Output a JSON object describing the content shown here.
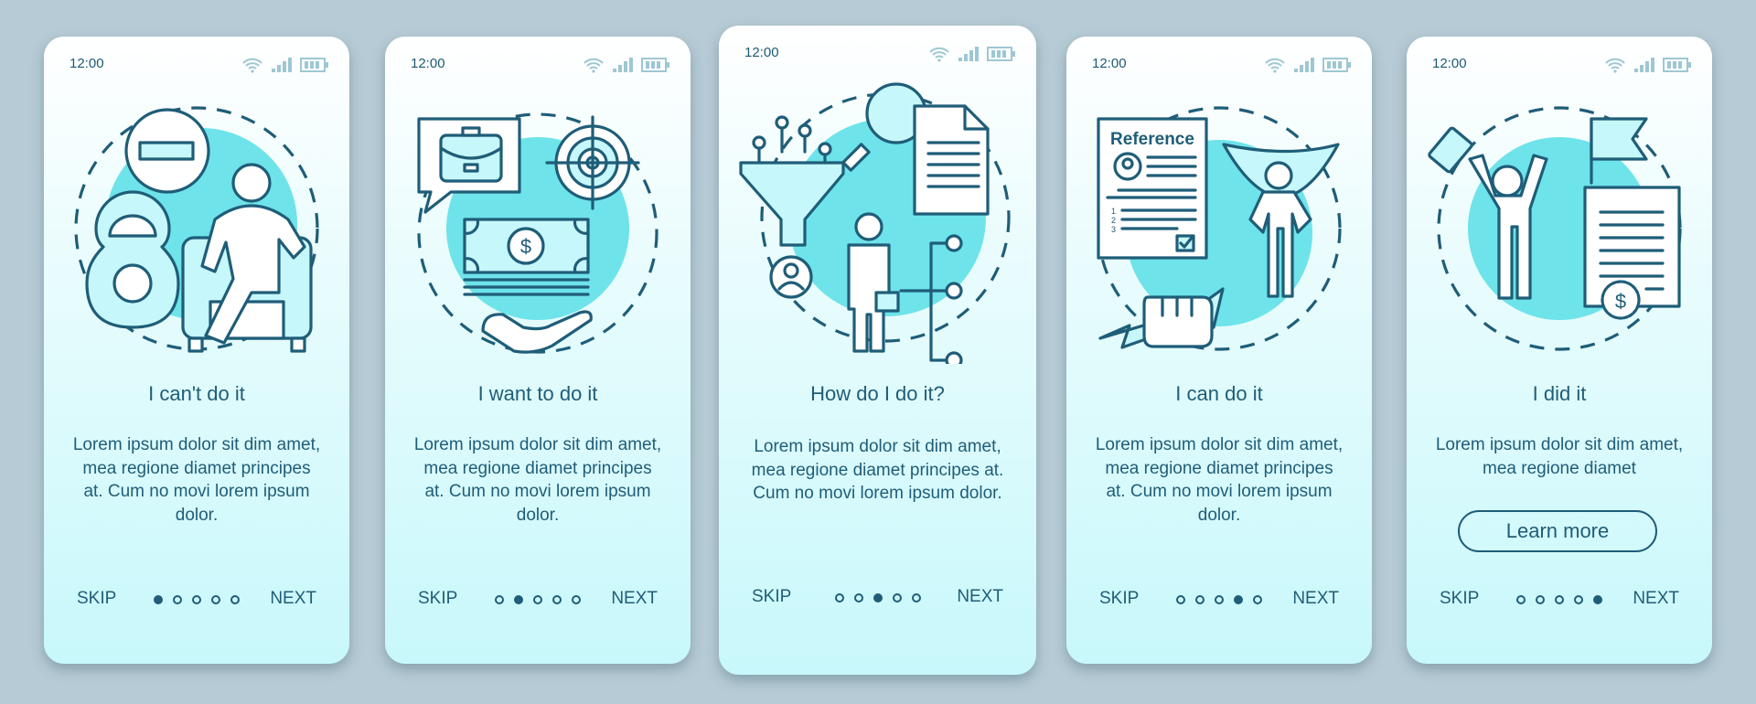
{
  "status_bar": {
    "time": "12:00",
    "icons": [
      "wifi-icon",
      "signal-icon",
      "battery-icon"
    ]
  },
  "colors": {
    "background": "#b6cbd5",
    "accent": "#6ee3ea",
    "text": "#1f5d78",
    "card_bottom": "#c8f8fb"
  },
  "screens": [
    {
      "title": "I can't do it",
      "description": "Lorem ipsum dolor sit dim amet, mea regione diamet principes at. Cum no movi lorem ipsum dolor.",
      "illustration": "person-in-armchair-with-kettlebell-and-minus-sign",
      "skip_label": "SKIP",
      "next_label": "NEXT",
      "page": 1,
      "total_pages": 5
    },
    {
      "title": "I want to do it",
      "description": "Lorem ipsum dolor sit dim amet, mea regione diamet principes at. Cum no movi lorem ipsum dolor.",
      "illustration": "briefcase-target-money-hand",
      "skip_label": "SKIP",
      "next_label": "NEXT",
      "page": 2,
      "total_pages": 5
    },
    {
      "title": "How do I do it?",
      "description": "Lorem ipsum dolor sit dim amet, mea regione diamet principes at. Cum no movi lorem ipsum dolor.",
      "illustration": "funnel-magnifier-document-businessman",
      "skip_label": "SKIP",
      "next_label": "NEXT",
      "page": 3,
      "total_pages": 5
    },
    {
      "title": "I can do it",
      "description": "Lorem ipsum dolor sit dim amet, mea regione diamet principes at. Cum no movi lorem ipsum dolor.",
      "illustration": "reference-document-superhero-fist",
      "reference_label": "Reference",
      "list_numbers": [
        "1",
        "2",
        "3"
      ],
      "skip_label": "SKIP",
      "next_label": "NEXT",
      "page": 4,
      "total_pages": 5
    },
    {
      "title": "I did it",
      "description": "Lorem ipsum dolor sit dim amet, mea regione diamet",
      "illustration": "celebrating-person-flag-certificate",
      "cta_label": "Learn more",
      "skip_label": "SKIP",
      "next_label": "NEXT",
      "page": 5,
      "total_pages": 5
    }
  ],
  "dollar_sign": "$"
}
